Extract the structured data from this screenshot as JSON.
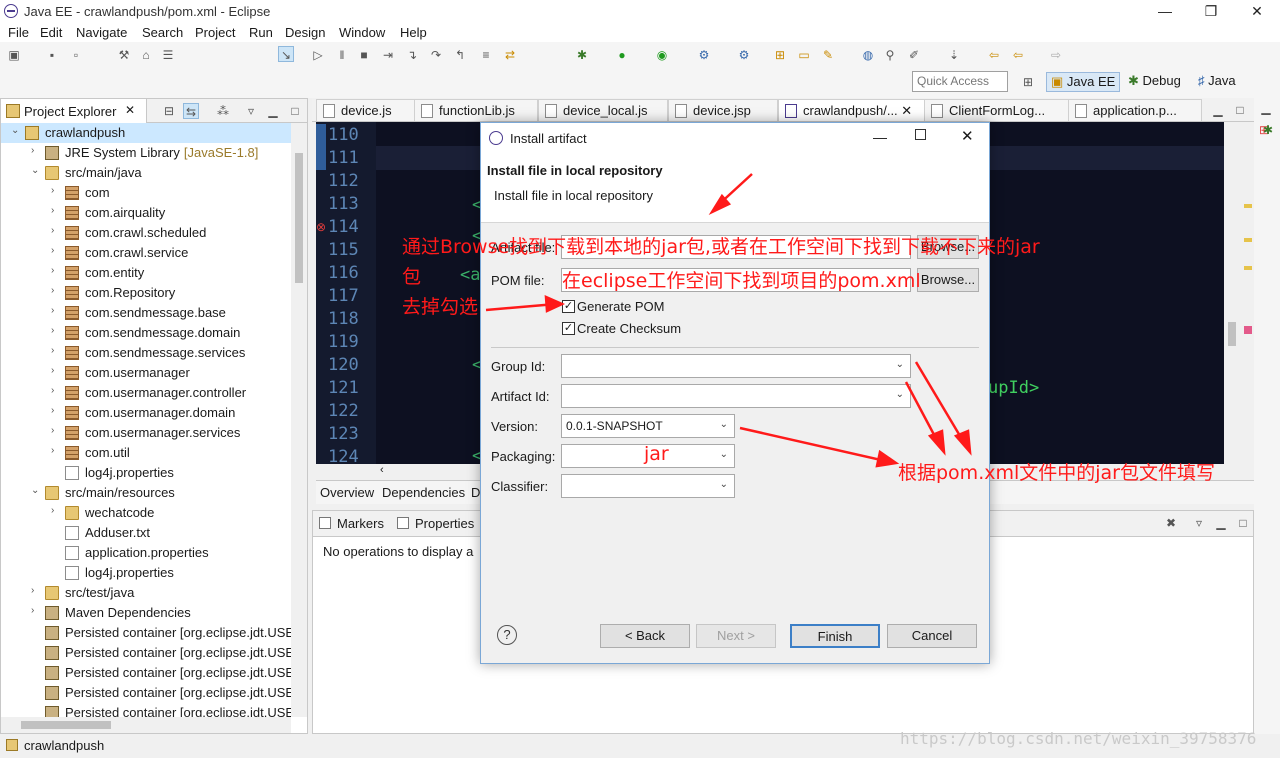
{
  "window": {
    "title": "Java EE - crawlandpush/pom.xml - Eclipse",
    "minimize": "—",
    "maximize": "❐",
    "close": "✕"
  },
  "menu": [
    "File",
    "Edit",
    "Navigate",
    "Search",
    "Project",
    "Run",
    "Design",
    "Window",
    "Help"
  ],
  "toolbar": {
    "quick_access_placeholder": "Quick Access",
    "perspectives": [
      "Java EE",
      "Debug",
      "Java"
    ]
  },
  "explorer": {
    "tab_label": "Project Explorer",
    "tab_close": "✕",
    "items": [
      {
        "label": "crawlandpush",
        "icon": "project-icon",
        "arrow": "⌄",
        "indent": 0,
        "selected": true
      },
      {
        "label": "JRE System Library",
        "decoration": "[JavaSE-1.8]",
        "icon": "library-icon",
        "arrow": "›",
        "indent": 1
      },
      {
        "label": "src/main/java",
        "icon": "source-folder-icon",
        "arrow": "⌄",
        "indent": 1
      },
      {
        "label": "com",
        "icon": "package-icon",
        "arrow": "›",
        "indent": 2
      },
      {
        "label": "com.airquality",
        "icon": "package-icon",
        "arrow": "›",
        "indent": 2
      },
      {
        "label": "com.crawl.scheduled",
        "icon": "package-icon",
        "arrow": "›",
        "indent": 2
      },
      {
        "label": "com.crawl.service",
        "icon": "package-icon",
        "arrow": "›",
        "indent": 2
      },
      {
        "label": "com.entity",
        "icon": "package-icon",
        "arrow": "›",
        "indent": 2
      },
      {
        "label": "com.Repository",
        "icon": "package-icon",
        "arrow": "›",
        "indent": 2
      },
      {
        "label": "com.sendmessage.base",
        "icon": "package-icon",
        "arrow": "›",
        "indent": 2
      },
      {
        "label": "com.sendmessage.domain",
        "icon": "package-icon",
        "arrow": "›",
        "indent": 2
      },
      {
        "label": "com.sendmessage.services",
        "icon": "package-icon",
        "arrow": "›",
        "indent": 2
      },
      {
        "label": "com.usermanager",
        "icon": "package-icon",
        "arrow": "›",
        "indent": 2
      },
      {
        "label": "com.usermanager.controller",
        "icon": "package-icon",
        "arrow": "›",
        "indent": 2
      },
      {
        "label": "com.usermanager.domain",
        "icon": "package-icon",
        "arrow": "›",
        "indent": 2
      },
      {
        "label": "com.usermanager.services",
        "icon": "package-icon",
        "arrow": "›",
        "indent": 2
      },
      {
        "label": "com.util",
        "icon": "package-icon",
        "arrow": "›",
        "indent": 2
      },
      {
        "label": "log4j.properties",
        "icon": "file-icon",
        "arrow": "",
        "indent": 2
      },
      {
        "label": "src/main/resources",
        "icon": "source-folder-icon",
        "arrow": "⌄",
        "indent": 1
      },
      {
        "label": "wechatcode",
        "icon": "folder-icon",
        "arrow": "›",
        "indent": 2
      },
      {
        "label": "Adduser.txt",
        "icon": "file-icon",
        "arrow": "",
        "indent": 2
      },
      {
        "label": "application.properties",
        "icon": "file-icon",
        "arrow": "",
        "indent": 2
      },
      {
        "label": "log4j.properties",
        "icon": "file-icon",
        "arrow": "",
        "indent": 2
      },
      {
        "label": "src/test/java",
        "icon": "source-folder-icon",
        "arrow": "›",
        "indent": 1
      },
      {
        "label": "Maven Dependencies",
        "icon": "library-icon",
        "arrow": "›",
        "indent": 1
      },
      {
        "label": "Persisted container [org.eclipse.jdt.USE",
        "icon": "library-icon",
        "arrow": "",
        "indent": 1
      },
      {
        "label": "Persisted container [org.eclipse.jdt.USE",
        "icon": "library-icon",
        "arrow": "",
        "indent": 1
      },
      {
        "label": "Persisted container [org.eclipse.jdt.USE",
        "icon": "library-icon",
        "arrow": "",
        "indent": 1
      },
      {
        "label": "Persisted container [org.eclipse.jdt.USE",
        "icon": "library-icon",
        "arrow": "",
        "indent": 1
      },
      {
        "label": "Persisted container [org.eclipse.jdt.USE",
        "icon": "library-icon",
        "arrow": "",
        "indent": 1
      }
    ]
  },
  "editor": {
    "tabs": [
      "device.js",
      "functionLib.js",
      "device_local.js",
      "device.jsp",
      "crawlandpush/...",
      "ClientFormLog...",
      "application.p..."
    ],
    "line_numbers": [
      "110",
      "111",
      "112",
      "113",
      "114",
      "115",
      "116",
      "117",
      "118",
      "119",
      "120",
      "121",
      "122",
      "123",
      "124"
    ],
    "code_fragment": "upId>",
    "bottom_tabs": [
      "Overview",
      "Dependencies",
      "D"
    ]
  },
  "markers": {
    "tabs": [
      "Markers",
      "Properties"
    ],
    "empty_text": "No operations to display a"
  },
  "status": {
    "selected": "crawlandpush"
  },
  "dialog": {
    "title": "Install artifact",
    "header_title": "Install file in local repository",
    "header_subtitle": "Install file in local repository",
    "artifact_file_label": "Artifact file:",
    "pom_file_label": "POM file:",
    "browse_label": "Browse...",
    "generate_pom_label": "Generate POM",
    "generate_pom_checked": true,
    "create_checksum_label": "Create Checksum",
    "create_checksum_checked": true,
    "group_id_label": "Group Id:",
    "artifact_id_label": "Artifact Id:",
    "version_label": "Version:",
    "version_value": "0.0.1-SNAPSHOT",
    "packaging_label": "Packaging:",
    "classifier_label": "Classifier:",
    "help_icon": "?",
    "back_label": "< Back",
    "next_label": "Next >",
    "finish_label": "Finish",
    "cancel_label": "Cancel"
  },
  "annotations": {
    "browse_note_line1": "通过Browse找到下载到本地的jar包,或者在工作空间下找到下载不下来的jar",
    "browse_note_line2": "包",
    "pom_note": "在eclipse工作空间下找到项目的pom.xml",
    "uncheck_note": "去掉勾选",
    "packaging_note": "jar",
    "fill_note": "根据pom.xml文件中的jar包文件填写",
    "color": "#ff1a1a"
  },
  "watermark": "https://blog.csdn.net/weixin_39758376",
  "colors": {
    "editor_bg": "#0d1021",
    "line_number": "#5d86b5",
    "dialog_border": "#7aa7d6"
  }
}
